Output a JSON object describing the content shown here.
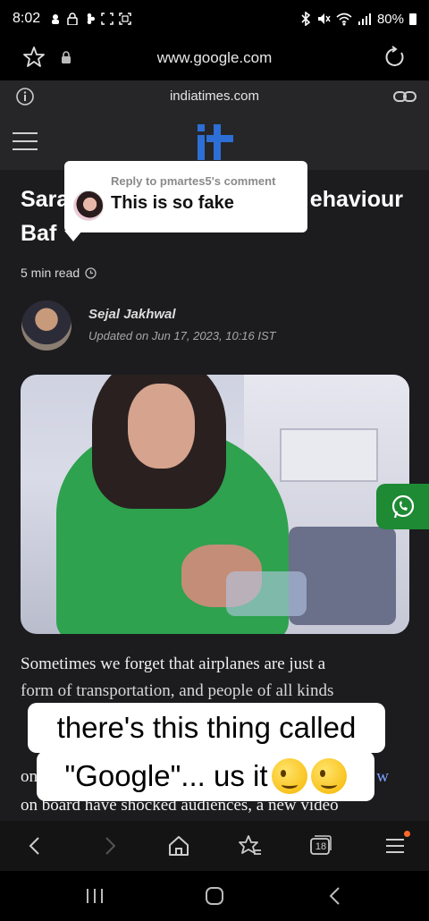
{
  "status_bar": {
    "time": "8:02",
    "battery": "80%"
  },
  "browser": {
    "url": "www.google.com"
  },
  "site_header": {
    "domain": "indiatimes.com"
  },
  "article": {
    "headline_line1": "Sara",
    "headline_line1_end": "ehaviour",
    "headline_line2": "Baf",
    "read_time": "5 min read",
    "author": "Sejal Jakhwal",
    "updated": "Updated on Jun 17, 2023, 10:16 IST",
    "paragraph1": "Sometimes we forget that airplanes are just a",
    "paragraph2": "form of transportation, and people of all kinds",
    "paragraph3_start": "on",
    "paragraph3_end": "w",
    "paragraph4": "on board have shocked audiences, a new video"
  },
  "reply_bubble": {
    "label": "Reply to pmartes5's comment",
    "text": "This is so fake"
  },
  "caption": {
    "line1": "there's this thing called",
    "line2": "\"Google\"...  us it"
  },
  "toolbar": {
    "tabs_count": "18"
  }
}
